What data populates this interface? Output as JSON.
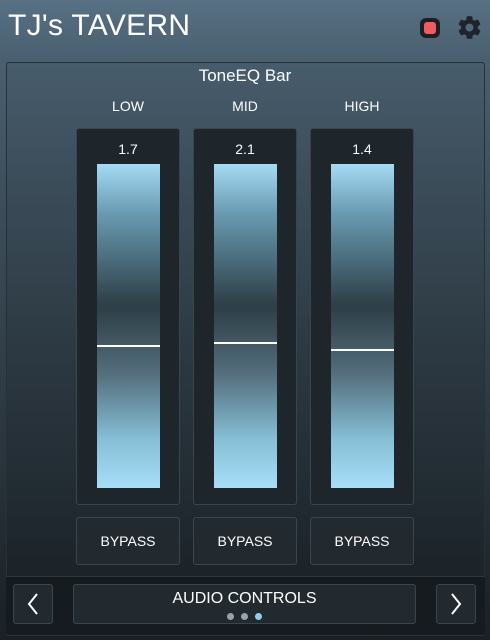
{
  "header": {
    "title": "TJ's TAVERN",
    "status_color": "#ee5b62",
    "settings_icon": "gear-icon"
  },
  "panel": {
    "title": "ToneEQ Bar",
    "bands": [
      {
        "label": "LOW",
        "value": "1.7",
        "level": 0.44,
        "bypass_label": "BYPASS"
      },
      {
        "label": "MID",
        "value": "2.1",
        "level": 0.45,
        "bypass_label": "BYPASS"
      },
      {
        "label": "HIGH",
        "value": "1.4",
        "level": 0.43,
        "bypass_label": "BYPASS"
      }
    ]
  },
  "footer": {
    "prev_icon": "chevron-left-icon",
    "next_icon": "chevron-right-icon",
    "page_name": "AUDIO CONTROLS",
    "page_count": 3,
    "active_page": 3
  },
  "colors": {
    "accent": "#8dcff0",
    "fader_top": "#a4dcf5",
    "fader_dark": "#2f4049",
    "header_bg": "#577083"
  }
}
